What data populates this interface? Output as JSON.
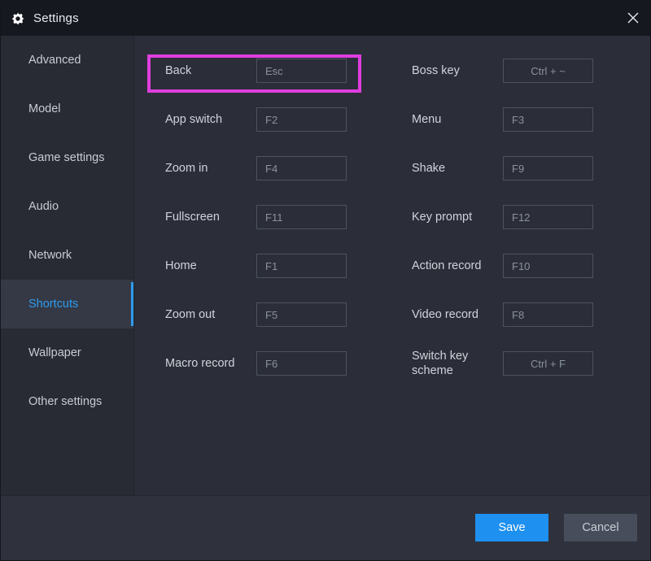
{
  "window": {
    "title": "Settings",
    "gear_icon": "gear-icon",
    "close_icon": "close-icon"
  },
  "sidebar": {
    "items": [
      {
        "label": "Advanced",
        "active": false
      },
      {
        "label": "Model",
        "active": false
      },
      {
        "label": "Game settings",
        "active": false
      },
      {
        "label": "Audio",
        "active": false
      },
      {
        "label": "Network",
        "active": false
      },
      {
        "label": "Shortcuts",
        "active": true
      },
      {
        "label": "Wallpaper",
        "active": false
      },
      {
        "label": "Other settings",
        "active": false
      }
    ]
  },
  "shortcuts": {
    "left_column": [
      {
        "label": "Back",
        "value": "Esc",
        "align": "left"
      },
      {
        "label": "App switch",
        "value": "F2",
        "align": "left"
      },
      {
        "label": "Zoom in",
        "value": "F4",
        "align": "left"
      },
      {
        "label": "Fullscreen",
        "value": "F11",
        "align": "left"
      },
      {
        "label": "Home",
        "value": "F1",
        "align": "left"
      },
      {
        "label": "Zoom out",
        "value": "F5",
        "align": "left"
      },
      {
        "label": "Macro record",
        "value": "F6",
        "align": "left"
      }
    ],
    "right_column": [
      {
        "label": "Boss key",
        "value": "Ctrl + ~",
        "align": "center"
      },
      {
        "label": "Menu",
        "value": "F3",
        "align": "left"
      },
      {
        "label": "Shake",
        "value": "F9",
        "align": "left"
      },
      {
        "label": "Key prompt",
        "value": "F12",
        "align": "left"
      },
      {
        "label": "Action record",
        "value": "F10",
        "align": "left"
      },
      {
        "label": "Video record",
        "value": "F8",
        "align": "left"
      },
      {
        "label": "Switch key scheme",
        "value": "Ctrl + F",
        "align": "center"
      }
    ]
  },
  "highlight": {
    "target": "Back",
    "color": "#e03de0"
  },
  "footer": {
    "save_label": "Save",
    "cancel_label": "Cancel",
    "save_color": "#1e90f0",
    "cancel_color": "#474d5a"
  }
}
